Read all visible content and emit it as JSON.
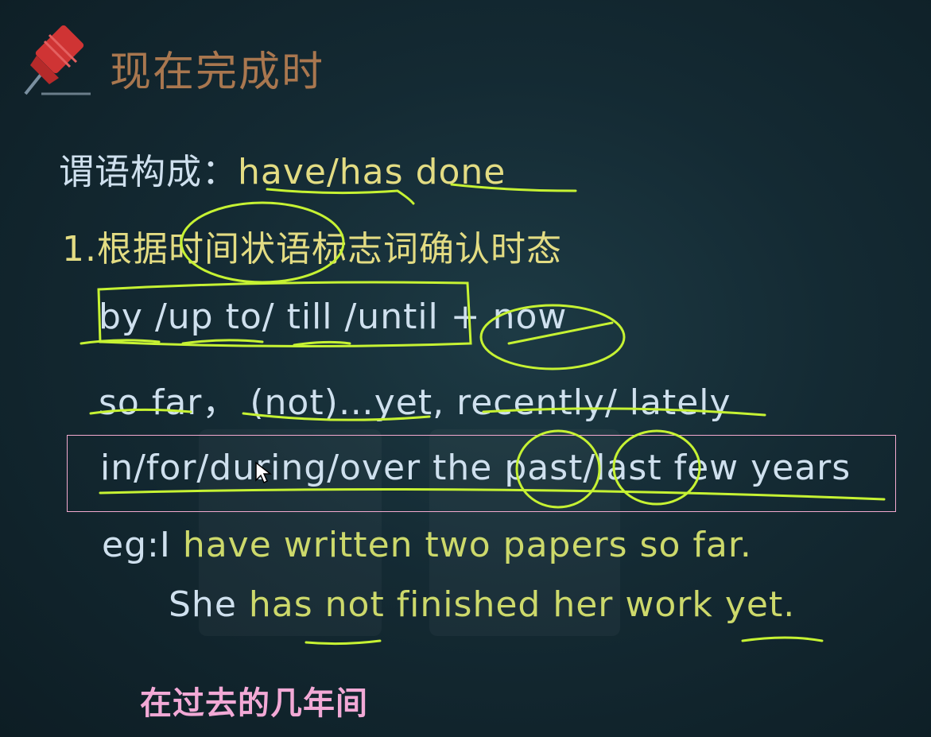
{
  "slide": {
    "title": "现在完成时",
    "line_predicate_label": "谓语构成：",
    "line_predicate_have": "have/has",
    "line_predicate_done": "done",
    "line_rule": "1.根据时间状语标志词确认时态",
    "line_by": "by /up to/ till /until + now",
    "line_sofar_1": "so far，",
    "line_sofar_2": "(not)…yet, recently/ lately",
    "line_past": "in/for/during/over the past/last few years",
    "example_1_prefix": "eg:I",
    "example_1_rest": "have written two papers so far.",
    "example_2_she": "She",
    "example_2_rest": "has not finished her work",
    "example_2_yet": "yet",
    "example_2_dot": ".",
    "subtitle": "在过去的几年间"
  },
  "colors": {
    "background": "#142a33",
    "title": "#a9774f",
    "english_text": "#cfe0ee",
    "chinese_yellow": "#e3dc83",
    "highlight_green": "#c6f233",
    "subtitle_pink": "#f2a9d6",
    "selection_box": "#f3a9cf"
  },
  "icons": [
    "pushpin-icon",
    "mouse-cursor-icon"
  ]
}
